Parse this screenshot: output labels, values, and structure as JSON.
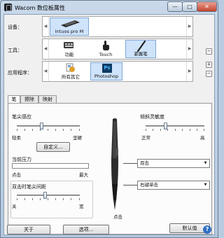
{
  "window": {
    "title": "Wacom 数位板属性",
    "min_label": "—",
    "max_label": "□",
    "close_label": "✕"
  },
  "rows": {
    "device": {
      "label": "设备：",
      "items": [
        {
          "label": "Intuos pro M",
          "icon": "tablet-icon",
          "selected": true
        }
      ]
    },
    "tool": {
      "label": "工具：",
      "items": [
        {
          "label": "功能",
          "icon": "keyboard-icon",
          "selected": false
        },
        {
          "label": "Touch",
          "icon": "touch-hand-icon",
          "selected": false
        },
        {
          "label": "紧握笔",
          "icon": "grip-pen-icon",
          "selected": true
        }
      ]
    },
    "application": {
      "label": "应用程序：",
      "items": [
        {
          "label": "所有其它",
          "icon": "all-apps-icon",
          "selected": false
        },
        {
          "label": "Photoshop",
          "icon": "photoshop-icon",
          "icon_text": "Ps",
          "selected": true
        }
      ]
    },
    "side_buttons": {
      "remove": "−",
      "add": "+"
    }
  },
  "tabs": [
    {
      "label": "笔",
      "active": true
    },
    {
      "label": "擦除",
      "active": false
    },
    {
      "label": "映射",
      "active": false
    }
  ],
  "pen_panel": {
    "tip_feel": {
      "title": "笔尖感应",
      "soft_label": "轻柔",
      "firm_label": "坚硬",
      "level": 0.4,
      "customize_button": "自定义..."
    },
    "current_pressure": {
      "title": "当前压力",
      "min_label": "点击",
      "max_label": "最大",
      "value": 0
    },
    "double_click_distance": {
      "title": "双击时笔尖间距",
      "off_label": "关",
      "wide_label": "宽",
      "level": 0.45
    },
    "tilt_sensitivity": {
      "title": "倾斜灵敏度",
      "normal_label": "正常",
      "high_label": "高",
      "level": 0.35
    },
    "side_switch_upper": {
      "value": "双击"
    },
    "side_switch_lower": {
      "value": "右键单击"
    },
    "tip_action": {
      "value": "点击"
    },
    "default_button": "默认值"
  },
  "footer": {
    "about_button": "关于",
    "options_button": "选项...",
    "help_icon_text": "?"
  },
  "colors": {
    "selection_fill": "#cfe3fb",
    "photoshop_blue": "#0f3b66",
    "photoshop_text": "#4fb7ff"
  }
}
